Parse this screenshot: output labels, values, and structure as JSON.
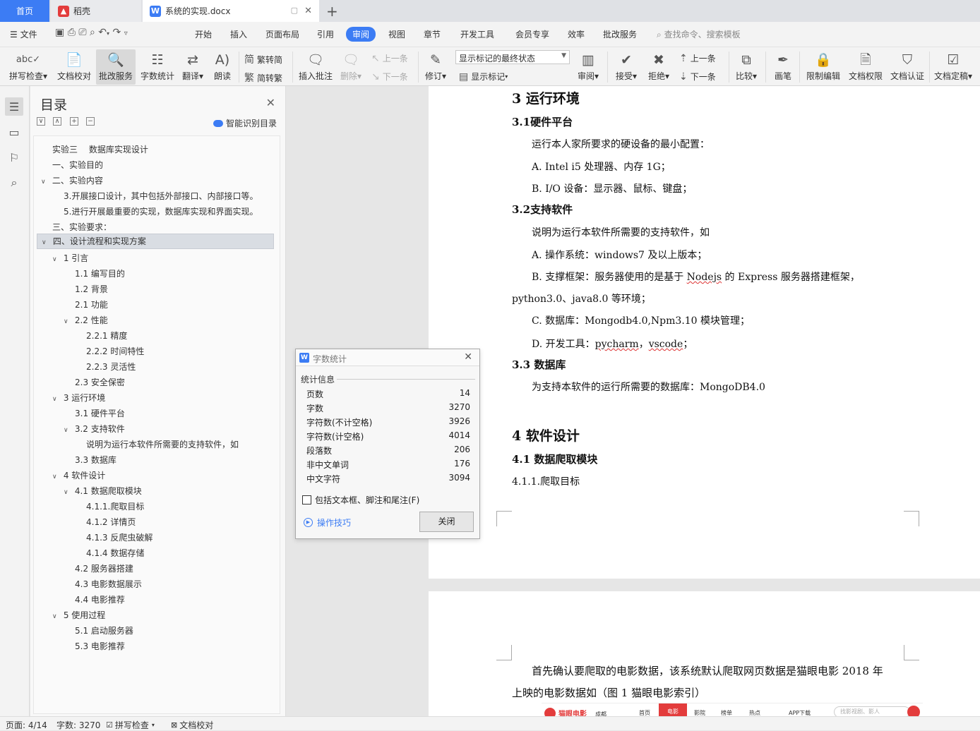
{
  "tabs": {
    "home": "首页",
    "daoke": "稻壳",
    "document": "系统的实现.docx",
    "new_tab": "+"
  },
  "menu": {
    "file": "文件",
    "items": [
      "开始",
      "插入",
      "页面布局",
      "引用",
      "审阅",
      "视图",
      "章节",
      "开发工具",
      "会员专享",
      "效率",
      "批改服务"
    ],
    "active": "审阅",
    "search": "查找命令、搜索模板"
  },
  "ribbon": {
    "spell_check": "拼写检查",
    "doc_proofread": "文档校对",
    "review_service": "批改服务",
    "word_count": "字数统计",
    "translate": "翻译",
    "read_aloud": "朗读",
    "trad_to_simp": "繁转简",
    "simp_to_trad": "简转繁",
    "insert_comment": "插入批注",
    "delete": "删除",
    "prev_comment": "上一条",
    "next_comment": "下一条",
    "track_changes": "修订",
    "markup_state": "显示标记的最终状态",
    "show_markup": "显示标记",
    "review": "审阅",
    "accept": "接受",
    "reject": "拒绝",
    "prev_change": "上一条",
    "next_change": "下一条",
    "compare": "比较",
    "pen": "画笔",
    "restrict_edit": "限制编辑",
    "doc_permission": "文档权限",
    "doc_certify": "文档认证",
    "doc_finalize": "文档定稿"
  },
  "toc": {
    "title": "目录",
    "smart": "智能识别目录",
    "items": [
      {
        "text": "实验三　 数据库实现设计"
      },
      {
        "text": "一、实验目的"
      },
      {
        "text": "二、实验内容"
      },
      {
        "text": "3.开展接口设计，其中包括外部接口、内部接口等。"
      },
      {
        "text": "5.进行开展最重要的实现，数据库实现和界面实现。"
      },
      {
        "text": "三、实验要求："
      },
      {
        "text": "四、设计流程和实现方案"
      },
      {
        "text": "1  引言"
      },
      {
        "text": "1.1  编写目的"
      },
      {
        "text": "1.2  背景"
      },
      {
        "text": "2.1 功能"
      },
      {
        "text": "2.2 性能"
      },
      {
        "text": "2.2.1  精度"
      },
      {
        "text": "2.2.2  时间特性"
      },
      {
        "text": "2.2.3  灵活性"
      },
      {
        "text": "2.3  安全保密"
      },
      {
        "text": "3  运行环境"
      },
      {
        "text": "3.1 硬件平台"
      },
      {
        "text": "3.2 支持软件"
      },
      {
        "text": "说明为运行本软件所需要的支持软件，如"
      },
      {
        "text": "3.3  数据库"
      },
      {
        "text": "4  软件设计"
      },
      {
        "text": "4.1  数据爬取模块"
      },
      {
        "text": "4.1.1.爬取目标"
      },
      {
        "text": "4.1.2  详情页"
      },
      {
        "text": "4.1.3  反爬虫破解"
      },
      {
        "text": "4.1.4  数据存储"
      },
      {
        "text": "4.2  服务器搭建"
      },
      {
        "text": "4.3 电影数据展示"
      },
      {
        "text": "4.4 电影推荐"
      },
      {
        "text": "5  使用过程"
      },
      {
        "text": "5.1  启动服务器"
      },
      {
        "text": "5.3  电影推荐"
      }
    ]
  },
  "document": {
    "h_env": "3  运行环境",
    "h_31": "3.1硬件平台",
    "p_31": "运行本人家所要求的硬设备的最小配置：",
    "p_31a": "A.  Intel i5 处理器、内存 1G；",
    "p_31b": "B.  I/O 设备：显示器、鼠标、键盘；",
    "h_32": "3.2支持软件",
    "p_32": "说明为运行本软件所需要的支持软件，如",
    "p_32a": "A.   操作系统：windows7 及以上版本；",
    "p_32b_pre": "B.   支撑框架：服务器使用的是基于 ",
    "p_32b_node": "Nodejs",
    "p_32b_post": " 的 Express 服务器搭建框架，",
    "p_32b2": "python3.0、java8.0 等环境；",
    "p_32c": "C.   数据库：Mongodb4.0,Npm3.10 模块管理；",
    "p_32d_pre": "D.   开发工具：",
    "p_32d_py": "pycharm",
    "p_32d_sep": "，",
    "p_32d_vs": "vscode",
    "p_32d_end": "；",
    "h_33": "3.3 数据库",
    "p_33": "为支持本软件的运行所需要的数据库：MongoDB4.0",
    "h_4": "4  软件设计",
    "h_41": "4.1 数据爬取模块",
    "p_411": "4.1.1.爬取目标",
    "p2_l1": "首先确认要爬取的电影数据，该系统默认爬取网页数据是猫眼电影 2018 年",
    "p2_l2": "上映的电影数据如（图 1 猫眼电影索引）",
    "img_brand": "猫眼电影",
    "img_city": "成都",
    "img_nav": [
      "首页",
      "电影",
      "影院",
      "榜单",
      "热点"
    ],
    "img_app": "APP下载",
    "img_search": "找影视剧、影人"
  },
  "dialog": {
    "title": "字数统计",
    "section": "统计信息",
    "rows": [
      {
        "label": "页数",
        "value": "14"
      },
      {
        "label": "字数",
        "value": "3270"
      },
      {
        "label": "字符数(不计空格)",
        "value": "3926"
      },
      {
        "label": "字符数(计空格)",
        "value": "4014"
      },
      {
        "label": "段落数",
        "value": "206"
      },
      {
        "label": "非中文单词",
        "value": "176"
      },
      {
        "label": "中文字符",
        "value": "3094"
      }
    ],
    "checkbox": "包括文本框、脚注和尾注(F)",
    "tips": "操作技巧",
    "close": "关闭"
  },
  "status": {
    "page": "页面: 4/14",
    "words": "字数: 3270",
    "spell": "拼写检查",
    "proof": "文档校对"
  },
  "colors": {
    "accent": "#3c7cf4",
    "daoke_red": "#e33c3c"
  }
}
